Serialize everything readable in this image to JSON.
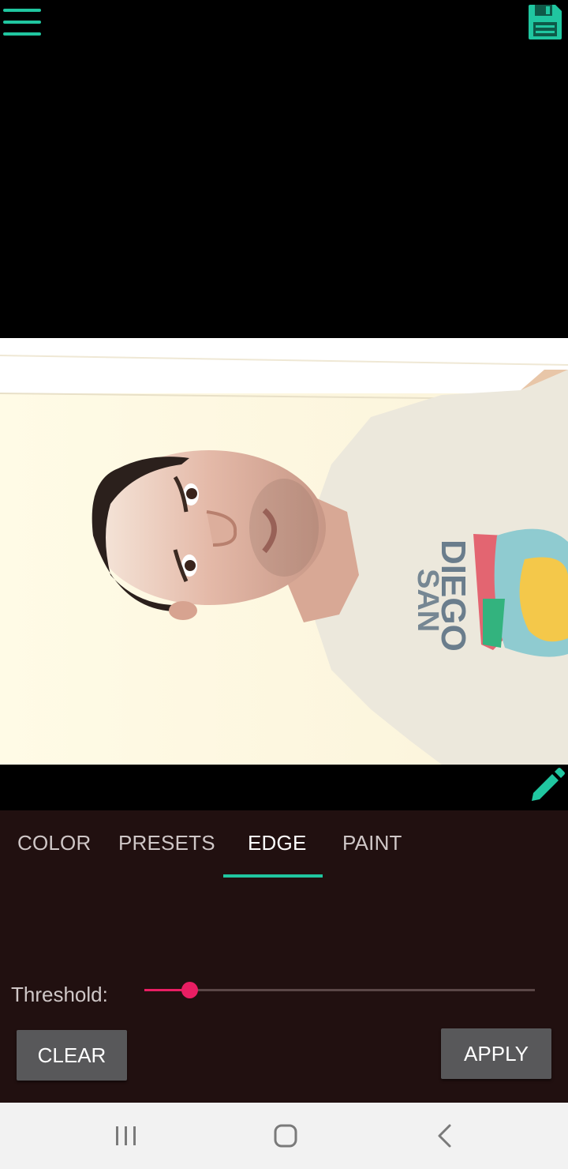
{
  "colors": {
    "background": "#000000",
    "accent": "#20c6a0",
    "panel_bg": "#211010",
    "tab_text": "#cfc7c7",
    "tab_active_text": "#ffffff",
    "slider_active": "#e91e63",
    "slider_track": "#5a4747",
    "button_bg": "#58585a",
    "nav_bg": "#f2f2f2",
    "nav_icon": "#7a7a7a"
  },
  "toolbar": {
    "menu_icon": "hamburger-menu-icon",
    "save_icon": "floppy-disk-save-icon"
  },
  "editor": {
    "edit_icon": "pencil-icon"
  },
  "tabs": [
    {
      "label": "COLOR",
      "active": false
    },
    {
      "label": "PRESETS",
      "active": false
    },
    {
      "label": "EDGE",
      "active": true
    },
    {
      "label": "PAINT",
      "active": false
    }
  ],
  "edge": {
    "threshold_label": "Threshold:",
    "threshold_value": 0.1
  },
  "actions": {
    "clear_label": "CLEAR",
    "apply_label": "APPLY"
  },
  "system_nav": {
    "recents_icon": "recents-icon",
    "home_icon": "home-icon",
    "back_icon": "back-icon"
  }
}
